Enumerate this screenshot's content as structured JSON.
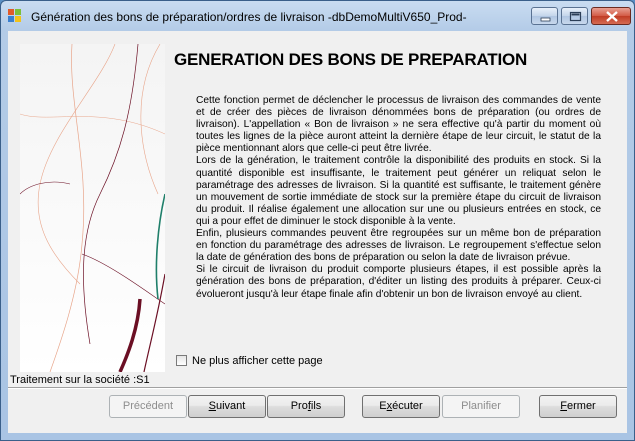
{
  "window": {
    "title": "Génération des bons de préparation/ordres de livraison -dbDemoMultiV650_Prod-"
  },
  "page": {
    "heading": "GENERATION DES BONS DE PREPARATION",
    "paragraphs": [
      "Cette fonction permet de déclencher le processus de livraison des commandes de vente et de créer des pièces de livraison dénommées bons de préparation (ou ordres de livraison). L'appellation « Bon de livraison » ne sera effective qu'à partir du moment où toutes les lignes de la pièce auront atteint la dernière étape de leur circuit, le statut de la pièce mentionnant alors que celle-ci peut être livrée.",
      "Lors de la génération, le traitement contrôle la disponibilité des produits en stock. Si la quantité disponible est insuffisante, le traitement peut générer un reliquat selon le paramétrage des adresses de livraison. Si la quantité est suffisante, le traitement génère un mouvement de sortie immédiate de stock sur la première étape du circuit de livraison du produit. Il réalise également une allocation sur une ou plusieurs entrées en stock, ce qui a pour effet de diminuer le stock disponible à la vente.",
      "Enfin, plusieurs commandes peuvent être regroupées sur un même bon de préparation en fonction du paramétrage des adresses de livraison. Le regroupement s'effectue selon la date de génération des bons de préparation ou selon la date de livraison prévue.",
      "Si le circuit de livraison du produit comporte plusieurs étapes, il est possible après la génération des bons de préparation, d'éditer un listing des produits à préparer. Ceux-ci évolueront jusqu'à leur étape finale afin d'obtenir un bon de livraison envoyé au client."
    ],
    "checkbox_label": "Ne plus afficher cette page",
    "company_status": "Traitement sur la société :S1"
  },
  "buttons": {
    "previous": {
      "pre": "Précédent",
      "ul": "",
      "post": ""
    },
    "next": {
      "pre": "",
      "ul": "S",
      "post": "uivant"
    },
    "profiles": {
      "pre": "Pro",
      "ul": "f",
      "post": "ils"
    },
    "execute": {
      "pre": "E",
      "ul": "x",
      "post": "écuter"
    },
    "schedule": {
      "pre": "Planifier",
      "ul": "",
      "post": ""
    },
    "close": {
      "pre": "",
      "ul": "F",
      "post": "ermer"
    }
  },
  "colors": {
    "art_teal": "#1f7f6a",
    "art_maroon": "#6b0f24",
    "art_salmon": "#e8a58a"
  }
}
